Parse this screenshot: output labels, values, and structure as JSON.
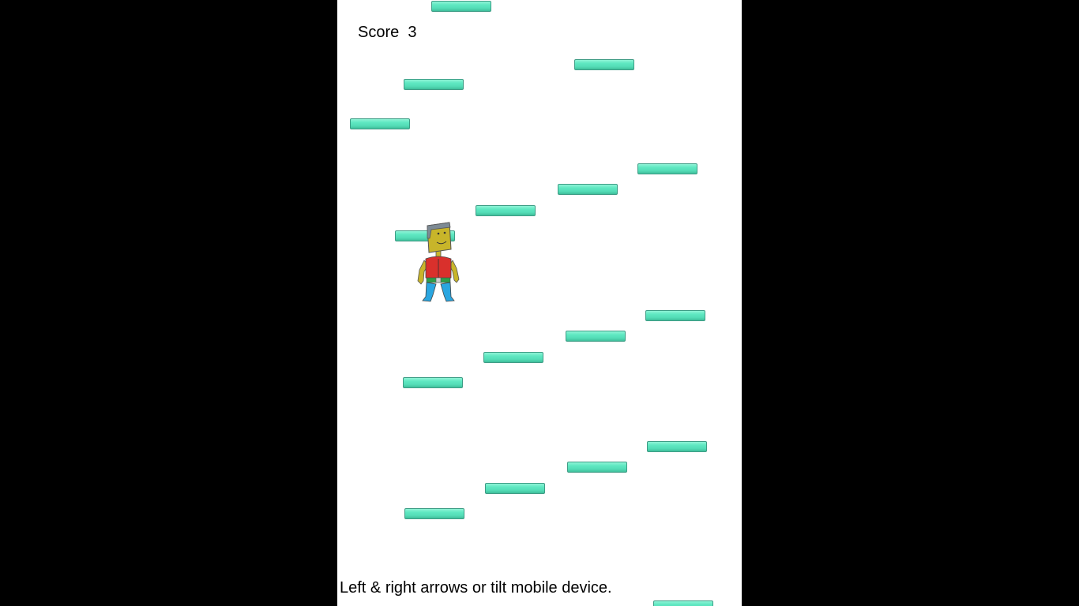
{
  "game": {
    "score_text": "Score  3",
    "instructions": "Left & right arrows or tilt mobile device."
  },
  "colors": {
    "background": "#000000",
    "play_area": "#ffffff",
    "platform": "#5fe8c2",
    "player_skin": "#c8b52a",
    "player_shirt": "#d9302c",
    "player_pants": "#2aa6e0"
  }
}
